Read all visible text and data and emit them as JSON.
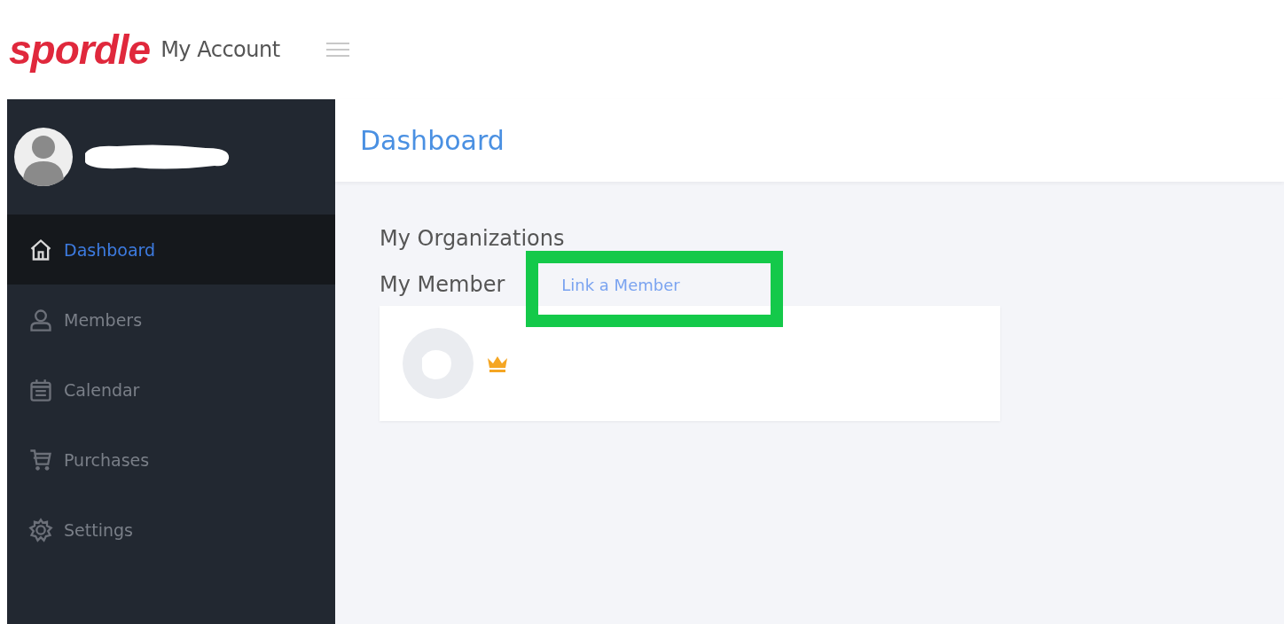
{
  "header": {
    "logo": "spordle",
    "title": "My Account"
  },
  "sidebar": {
    "items": [
      {
        "label": "Dashboard",
        "selected": true
      },
      {
        "label": "Members",
        "selected": false
      },
      {
        "label": "Calendar",
        "selected": false
      },
      {
        "label": "Purchases",
        "selected": false
      },
      {
        "label": "Settings",
        "selected": false
      }
    ]
  },
  "page_title": "Dashboard",
  "organizations": {
    "heading": "My Organizations"
  },
  "members": {
    "heading": "My Member",
    "link": "Link a Member",
    "cards": [
      {
        "owner": true
      }
    ]
  }
}
